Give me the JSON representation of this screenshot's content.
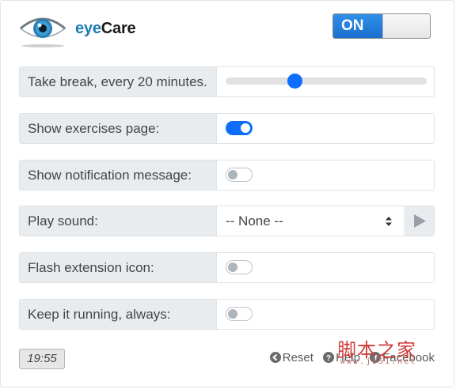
{
  "brand": {
    "part1": "eye",
    "part2": "Care"
  },
  "power_toggle": {
    "label": "ON"
  },
  "settings": {
    "break_label": "Take break, every 20 minutes.",
    "break_slider_value": 20,
    "break_slider_range": [
      0,
      60
    ],
    "exercises_label": "Show exercises page:",
    "exercises_enabled": true,
    "notification_label": "Show notification message:",
    "notification_enabled": false,
    "sound_label": "Play sound:",
    "sound_selected": "-- None --",
    "flash_label": "Flash extension icon:",
    "flash_enabled": false,
    "keep_running_label": "Keep it running, always:",
    "keep_running_enabled": false
  },
  "footer": {
    "clock": "19:55",
    "reset_label": "Reset",
    "help_label": "Help",
    "facebook_label": "Facebook"
  },
  "watermark": {
    "text": "脚本之家",
    "url": "www.jb51.net"
  },
  "colors": {
    "accent": "#0d6efd",
    "brand_blue": "#1e7bb0",
    "label_bg": "#e9ecef"
  }
}
